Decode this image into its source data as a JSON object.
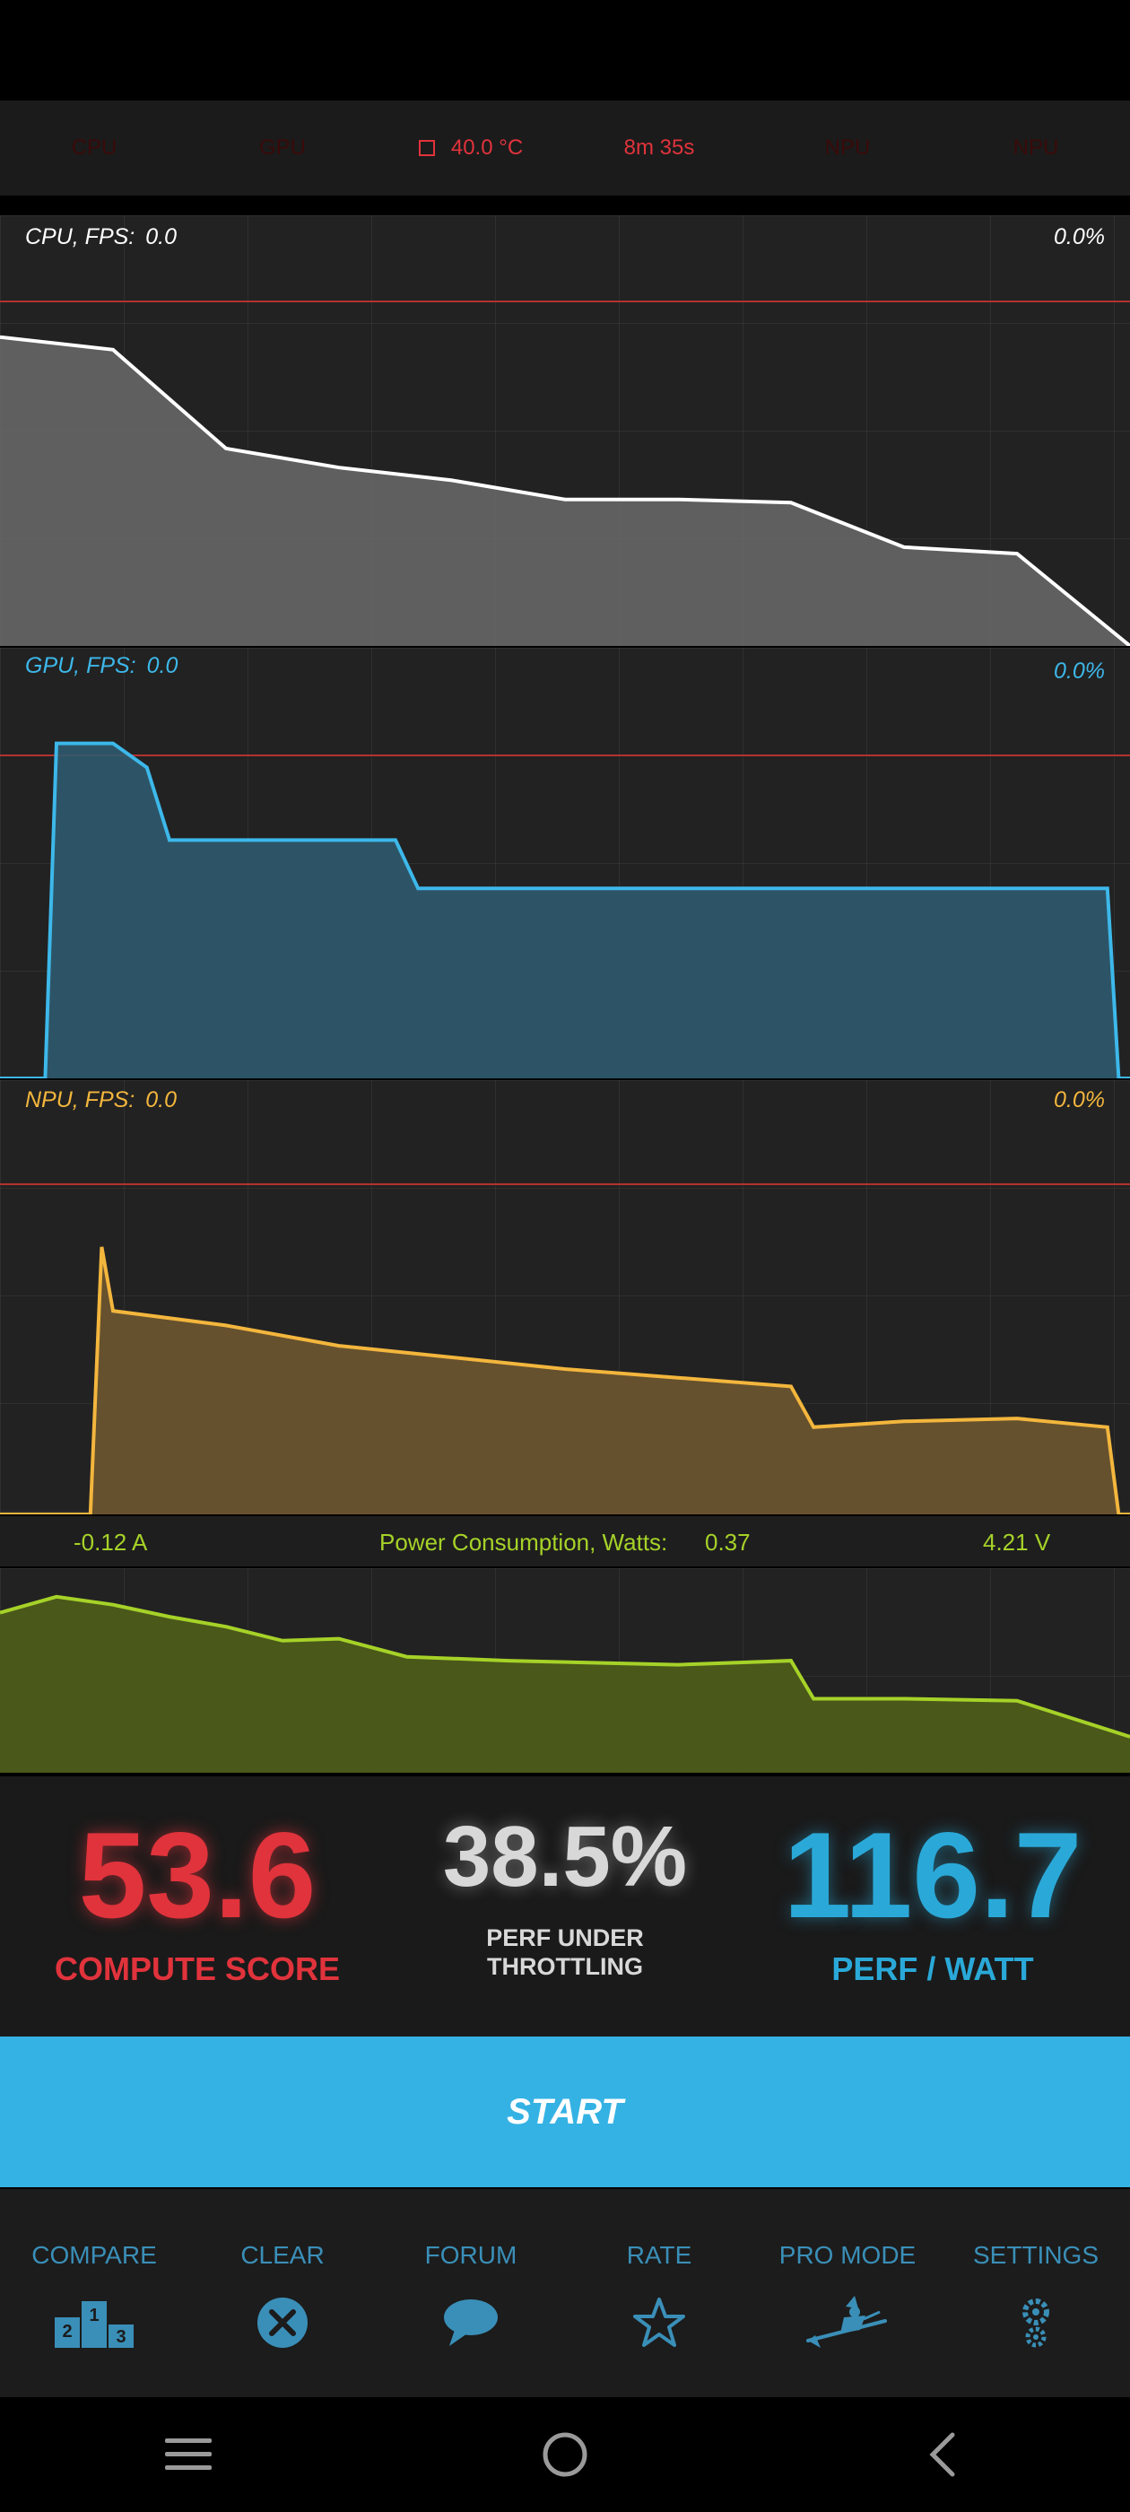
{
  "top_bar": {
    "cpu_label": "CPU",
    "gpu_label": "GPU",
    "temperature": "40.0 °C",
    "elapsed": "8m 35s",
    "npu_label_1": "NPU",
    "npu_label_2": "NPU"
  },
  "cpu_panel": {
    "label": "CPU, FPS:",
    "fps": "0.0",
    "percent": "0.0%"
  },
  "gpu_panel": {
    "label": "GPU, FPS:",
    "fps": "0.0",
    "percent": "0.0%"
  },
  "npu_panel": {
    "label": "NPU, FPS:",
    "fps": "0.0",
    "percent": "0.0%"
  },
  "power": {
    "current": "-0.12 A",
    "label": "Power Consumption, Watts:",
    "watts": "0.37",
    "voltage": "4.21 V"
  },
  "scores": {
    "compute_value": "53.6",
    "compute_label": "COMPUTE SCORE",
    "throttle_value": "38.5%",
    "throttle_label_1": "PERF UNDER",
    "throttle_label_2": "THROTTLING",
    "perfwatt_value": "116.7",
    "perfwatt_label": "PERF / WATT"
  },
  "start_button": {
    "label": "START"
  },
  "bottom_nav": {
    "compare": "COMPARE",
    "clear": "CLEAR",
    "forum": "FORUM",
    "rate": "RATE",
    "pro_mode": "PRO MODE",
    "settings": "SETTINGS"
  },
  "colors": {
    "cpu_line": "#ffffff",
    "gpu_line": "#3db8ea",
    "npu_line": "#f3b63d",
    "power_line": "#a6d228",
    "accent_red": "#e0333c",
    "accent_blue": "#35b2e4"
  },
  "chart_data": [
    {
      "type": "area",
      "name": "CPU",
      "x": [
        0,
        10,
        20,
        30,
        40,
        50,
        60,
        70,
        80,
        90,
        100
      ],
      "y": [
        97,
        93,
        62,
        56,
        52,
        46,
        46,
        45,
        31,
        29,
        0
      ]
    },
    {
      "type": "area",
      "name": "GPU",
      "x": [
        0,
        4,
        5,
        10,
        13,
        15,
        30,
        35,
        37,
        50,
        70,
        90,
        98,
        99,
        100
      ],
      "y": [
        0,
        0,
        97,
        97,
        90,
        69,
        69,
        69,
        55,
        55,
        55,
        55,
        55,
        0,
        0
      ]
    },
    {
      "type": "area",
      "name": "NPU",
      "x": [
        0,
        8,
        9,
        10,
        20,
        30,
        40,
        50,
        60,
        70,
        72,
        80,
        90,
        98,
        99,
        100
      ],
      "y": [
        0,
        0,
        92,
        70,
        65,
        58,
        54,
        50,
        47,
        44,
        30,
        32,
        33,
        30,
        0,
        0
      ]
    },
    {
      "type": "area",
      "name": "Power",
      "x": [
        0,
        5,
        10,
        15,
        20,
        25,
        30,
        36,
        45,
        60,
        70,
        72,
        80,
        90,
        100
      ],
      "y": [
        80,
        88,
        84,
        78,
        73,
        66,
        67,
        58,
        56,
        54,
        56,
        37,
        37,
        36,
        18
      ]
    }
  ]
}
